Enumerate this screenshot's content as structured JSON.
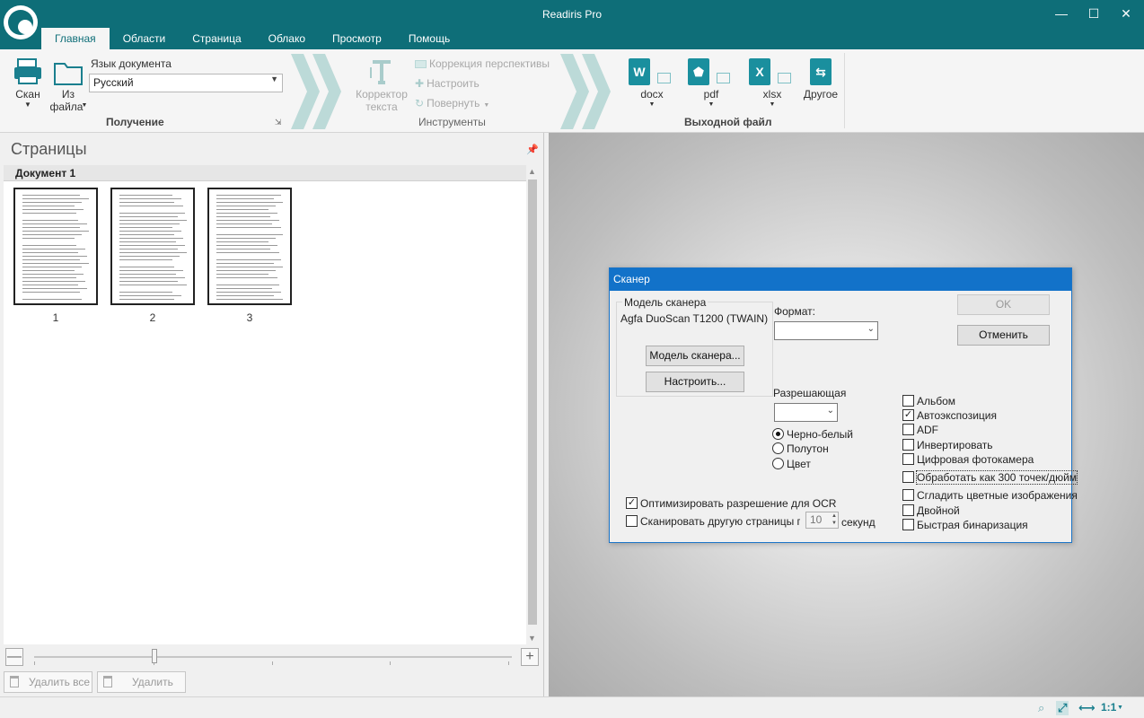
{
  "window": {
    "title": "Readiris Pro",
    "min": "—",
    "max": "☐",
    "close": "✕"
  },
  "tabs": [
    "Главная",
    "Области",
    "Страница",
    "Облако",
    "Просмотр",
    "Помощь"
  ],
  "ribbon": {
    "acquire": {
      "scan_label": "Скан",
      "from_file_line1": "Из",
      "from_file_line2": "файла",
      "lang_label": "Язык документа",
      "lang_value": "Русский",
      "group_title": "Получение"
    },
    "tools": {
      "corrector_line1": "Корректор",
      "corrector_line2": "текста",
      "perspective": "Коррекция перспективы",
      "configure": "Настроить",
      "rotate": "Повернуть",
      "group_title": "Инструменты"
    },
    "output": {
      "docx": "docx",
      "pdf": "pdf",
      "xlsx": "xlsx",
      "other": "Другое",
      "group_title": "Выходной файл"
    }
  },
  "pages_pane": {
    "title": "Страницы",
    "document_name": "Документ 1",
    "pages": [
      "1",
      "2",
      "3"
    ],
    "delete_all": "Удалить все",
    "delete": "Удалить"
  },
  "scanner_dialog": {
    "title": "Сканер",
    "model_group_title": "Модель сканера",
    "model_name": "Agfa DuoScan T1200 (TWAIN)",
    "model_button": "Модель сканера...",
    "configure_button": "Настроить...",
    "format_label": "Формат:",
    "resolution_label": "Разрешающая",
    "ok_button": "OK",
    "cancel_button": "Отменить",
    "color_modes": [
      {
        "label": "Черно-белый",
        "selected": true
      },
      {
        "label": "Полутон",
        "selected": false
      },
      {
        "label": "Цвет",
        "selected": false
      }
    ],
    "options": [
      {
        "label": "Альбом",
        "checked": false
      },
      {
        "label": "Автоэкспозиция",
        "checked": true
      },
      {
        "label": "ADF",
        "checked": false
      },
      {
        "label": "Инвертировать",
        "checked": false
      },
      {
        "label": "Цифровая фотокамера",
        "checked": false
      },
      {
        "label": "Обработать как 300 точек/дюйм",
        "checked": false
      },
      {
        "label": "Сгладить цветные изображения",
        "checked": false
      },
      {
        "label": "Двойной",
        "checked": false
      },
      {
        "label": "Быстрая бинаризация",
        "checked": false
      }
    ],
    "optimize_ocr": {
      "label": "Оптимизировать разрешение для OCR",
      "checked": true
    },
    "scan_other_page": {
      "label": "Сканировать другую страницы посл",
      "checked": false
    },
    "delay_value": "10",
    "seconds_label": "секунд"
  },
  "statusbar": {
    "ratio": "1:1"
  },
  "colors": {
    "accent": "#0e6e78",
    "dialog_title": "#1272c9"
  }
}
